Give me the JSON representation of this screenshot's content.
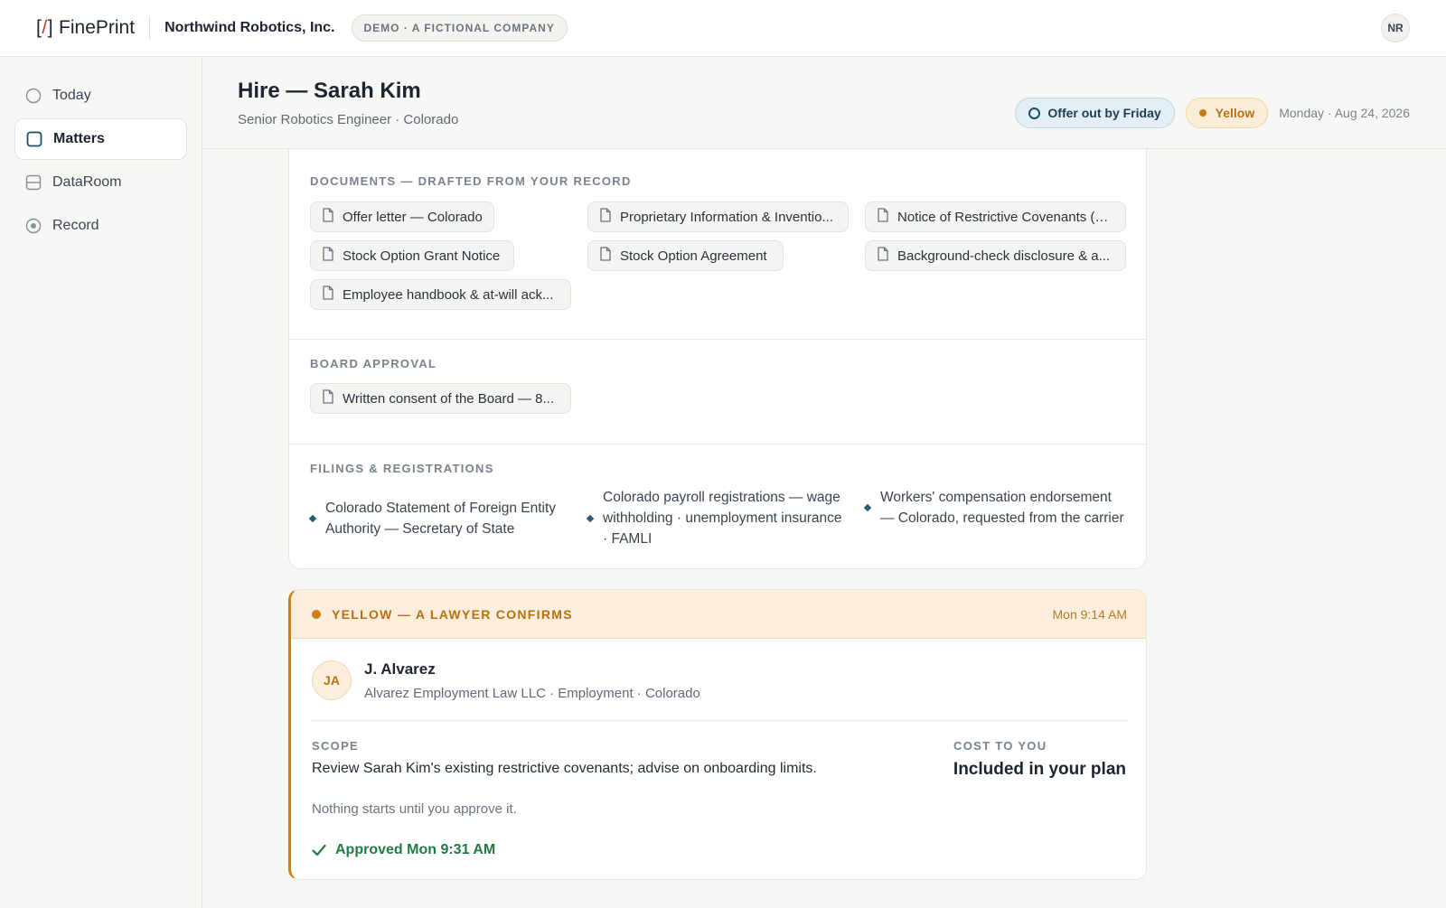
{
  "app": {
    "logo_mark": "[/]",
    "logo_text": "FinePrint",
    "company": "Northwind Robotics, Inc.",
    "demo_badge": "DEMO · A FICTIONAL COMPANY",
    "user_initials": "NR"
  },
  "sidebar": {
    "items": [
      {
        "label": "Today",
        "icon": "circle-icon"
      },
      {
        "label": "Matters",
        "icon": "square-icon",
        "active": true
      },
      {
        "label": "DataRoom",
        "icon": "drawer-icon"
      },
      {
        "label": "Record",
        "icon": "target-icon"
      }
    ]
  },
  "header": {
    "title": "Hire — Sarah Kim",
    "subtitle": "Senior Robotics Engineer · Colorado",
    "deadline": "Offer out by Friday",
    "status": "Yellow",
    "date": "Monday · Aug 24, 2026"
  },
  "documents": {
    "label": "DOCUMENTS — DRAFTED FROM YOUR RECORD",
    "items": [
      "Offer letter — Colorado",
      "Proprietary Information & Inventio...",
      "Notice of Restrictive Covenants (C...",
      "Stock Option Grant Notice",
      "Stock Option Agreement",
      "Background-check disclosure & a...",
      "Employee handbook & at-will ack..."
    ]
  },
  "board": {
    "label": "BOARD APPROVAL",
    "items": [
      "Written consent of the Board — 8..."
    ]
  },
  "filings": {
    "label": "FILINGS & REGISTRATIONS",
    "items": [
      "Colorado Statement of Foreign Entity Authority — Secretary of State",
      "Colorado payroll registrations — wage withholding · unemployment insurance · FAMLI",
      "Workers' compensation endorsement — Colorado, requested from the carrier"
    ]
  },
  "review": {
    "title": "YELLOW — A LAWYER CONFIRMS",
    "time": "Mon 9:14 AM",
    "lawyer_initials": "JA",
    "lawyer_name": "J. Alvarez",
    "lawyer_meta": "Alvarez Employment Law LLC · Employment · Colorado",
    "scope_label": "SCOPE",
    "scope_text": "Review Sarah Kim's existing restrictive covenants; advise on onboarding limits.",
    "cost_label": "COST TO YOU",
    "cost_value": "Included in your plan",
    "note": "Nothing starts until you approve it.",
    "approved": "Approved Mon 9:31 AM"
  },
  "colors": {
    "accent_yellow": "#c8801a",
    "approved_green": "#237a43",
    "deadline_blue": "#1f4e66"
  }
}
